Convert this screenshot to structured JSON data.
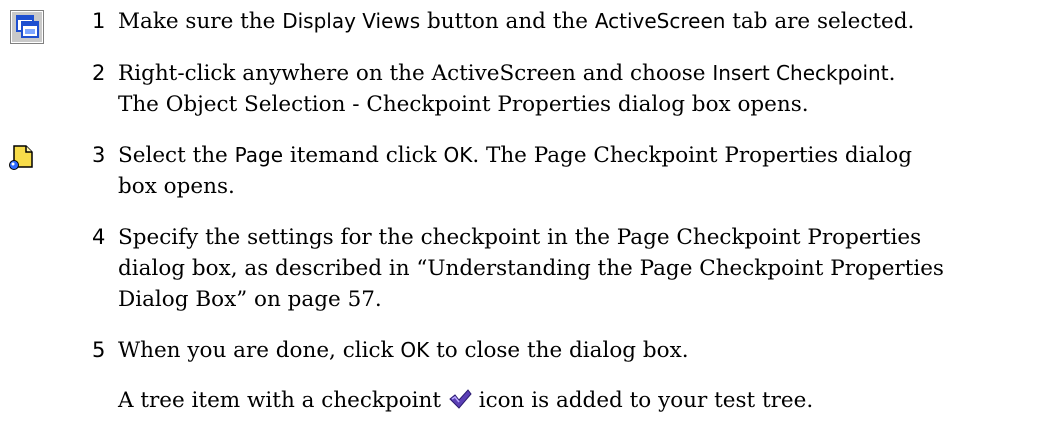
{
  "icons": {
    "display_views": "display-views-icon",
    "page": "page-icon",
    "checkpoint": "checkpoint-icon"
  },
  "steps": [
    {
      "num": "1",
      "t1": "Make sure the ",
      "b1": "Display Views",
      "t2": " button and the ",
      "b2": "ActiveScreen",
      "t3": " tab are selected."
    },
    {
      "num": "2",
      "t1": "Right-click anywhere on the ActiveScreen and choose ",
      "b1": "Insert Checkpoint",
      "t2": ".",
      "line2": "The Object Selection - Checkpoint Properties dialog box opens."
    },
    {
      "num": "3",
      "t1": "Select the ",
      "b1": "Page",
      "t2": " itemand click ",
      "b2": "OK",
      "t3": ". The Page Checkpoint Properties dialog",
      "line2": "box opens."
    },
    {
      "num": "4",
      "line1": "Specify the settings for the checkpoint in the Page Checkpoint Properties",
      "line2": "dialog box, as described in “Understanding the Page Checkpoint Properties",
      "line3": "Dialog Box” on page 57."
    },
    {
      "num": "5",
      "t1": "When you are done, click ",
      "b1": "OK",
      "t2": " to close the dialog box."
    }
  ],
  "result": {
    "t1": "A tree item with a checkpoint ",
    "t2": " icon is added to your test tree."
  },
  "colors": {
    "icon_blue": "#1e4fd0",
    "icon_yellow": "#f7dc4a",
    "checkmark_purple": "#5b3fb5"
  }
}
